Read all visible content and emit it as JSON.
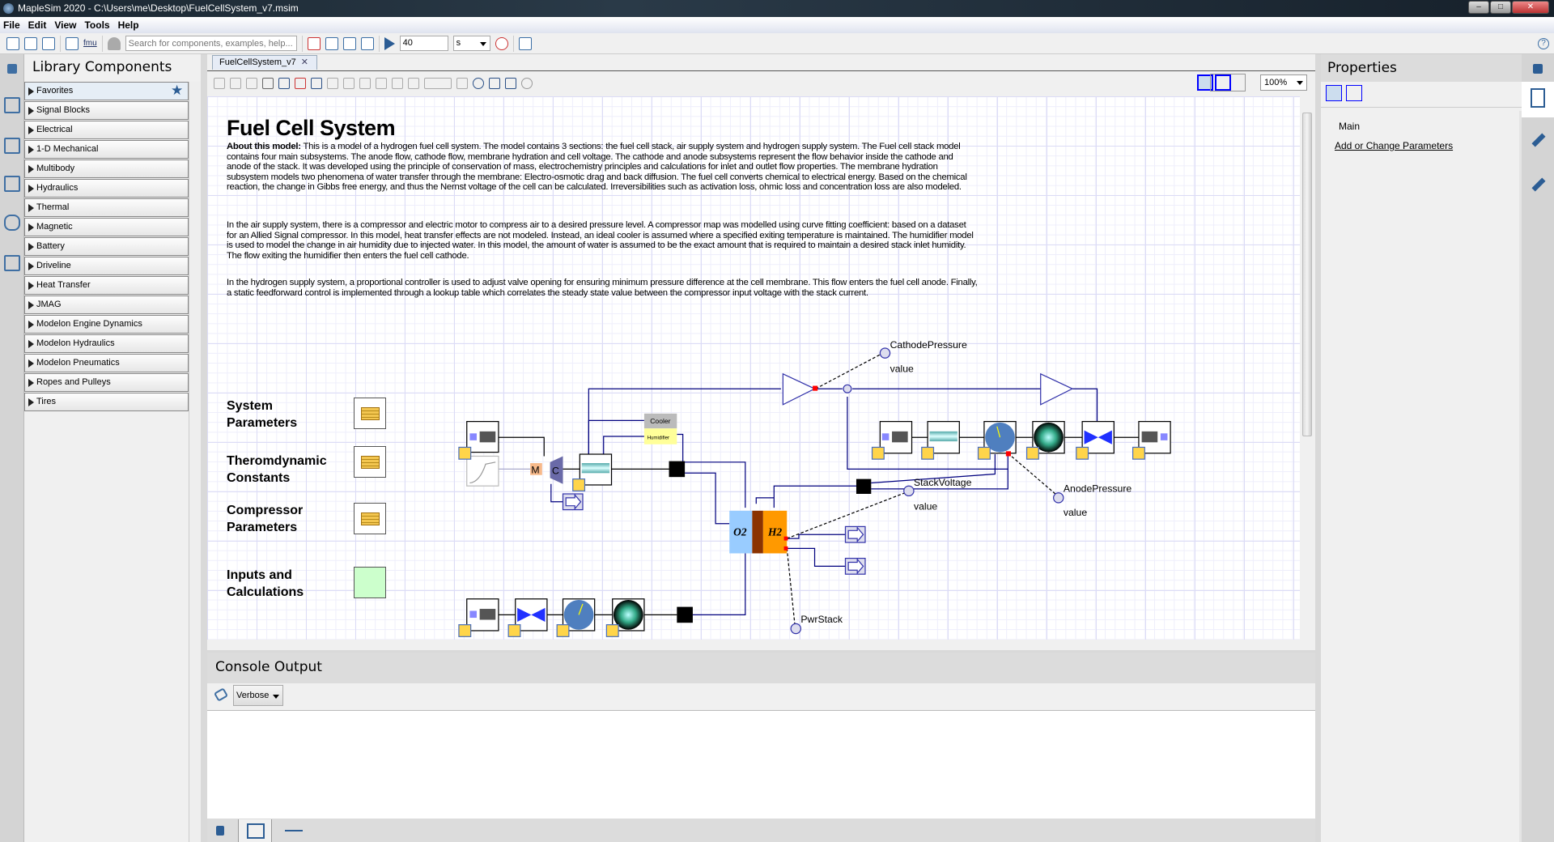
{
  "window": {
    "title": "MapleSim 2020 -  C:\\Users\\me\\Desktop\\FuelCellSystem_v7.msim",
    "controls": [
      "minimize",
      "maximize",
      "close"
    ]
  },
  "menu": [
    "File",
    "Edit",
    "View",
    "Tools",
    "Help"
  ],
  "toolbar": {
    "search_placeholder": "Search for components, examples, help...",
    "sim_time": "40",
    "time_unit": "s",
    "fmu_label": "fmu"
  },
  "library": {
    "title": "Library Components",
    "items": [
      "Favorites",
      "Signal Blocks",
      "Electrical",
      "1-D Mechanical",
      "Multibody",
      "Hydraulics",
      "Thermal",
      "Magnetic",
      "Battery",
      "Driveline",
      "Heat Transfer",
      "JMAG",
      "Modelon Engine Dynamics",
      "Modelon Hydraulics",
      "Modelon Pneumatics",
      "Ropes and Pulleys",
      "Tires"
    ]
  },
  "editor": {
    "tab": "FuelCellSystem_v7",
    "zoom": "100%"
  },
  "document": {
    "title": "Fuel Cell System",
    "about_label": "About this model:",
    "p1": " This is a model of a hydrogen fuel cell system. The model contains 3 sections: the fuel cell stack, air supply system and hydrogen supply system. The Fuel cell stack model contains four main subsystems. The anode flow, cathode flow, membrane hydration and cell voltage. The cathode and anode subsystems represent the flow behavior inside the cathode and anode of the stack. It was developed using the principle of conservation of mass, electrochemistry principles and calculations for inlet and outlet flow properties. The membrane hydration subsystem models two phenomena of water transfer through the membrane: Electro-osmotic drag and back diffusion. The fuel cell converts chemical to electrical energy. Based on the chemical reaction, the change in Gibbs free energy, and thus the Nernst voltage of the cell can be calculated. Irreversibilities such as activation loss, ohmic loss and concentration loss are also modeled.",
    "p2": "In the air supply system, there is a compressor and electric motor to compress air to a desired pressure level. A compressor map was modelled using curve fitting coefficient: based on a dataset for an Allied Signal compressor.  In this model, heat transfer effects are not modeled. Instead, an ideal cooler is assumed where a specified exiting temperature is maintained.  The humidifier model is used to model the change in air humidity due to injected water. In this model, the amount of water is assumed to be the exact amount that is required to maintain a desired stack inlet humidity. The flow exiting the humidifier then enters the fuel cell cathode.",
    "p3": "In the hydrogen supply system, a proportional controller is used to adjust valve opening for ensuring minimum pressure difference at the cell membrane. This flow enters the fuel cell anode. Finally, a static feedforward control is implemented through a lookup table which correlates the steady state value between the compressor input voltage with the stack current.",
    "blocks": [
      "System Parameters",
      "Theromdynamic Constants",
      "Compressor Parameters",
      "Inputs and Calculations"
    ]
  },
  "diagram": {
    "cathode_pressure": "CathodePressure",
    "anode_pressure": "AnodePressure",
    "stack_voltage": "StackVoltage",
    "pwr_stack": "PwrStack",
    "value": "value",
    "cooler": "Cooler",
    "humidifier": "Humidifier",
    "motor": "M",
    "compressor": "C",
    "o2": "O2",
    "h2": "H2"
  },
  "console": {
    "title": "Console Output",
    "level": "Verbose"
  },
  "properties": {
    "title": "Properties",
    "section": "Main",
    "link": "Add or Change Parameters"
  }
}
